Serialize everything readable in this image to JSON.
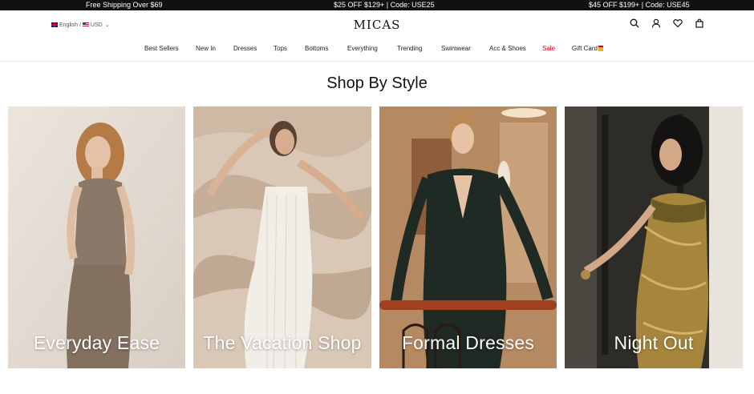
{
  "promo": {
    "left": "Free Shipping Over $69",
    "center": "$25 OFF $129+ | Code: USE25",
    "right": "$45 OFF $199+ | Code: USE45"
  },
  "header": {
    "language": "English",
    "separator": "/",
    "currency": "USD",
    "logo": "MICAS"
  },
  "nav": {
    "items": [
      "Best Sellers",
      "New In",
      "Dresses",
      "Tops",
      "Bottoms",
      "Everything",
      "Trending",
      "Swimwear",
      "Acc & Shoes",
      "Sale",
      "Gift Card"
    ]
  },
  "section": {
    "title": "Shop By Style"
  },
  "cards": [
    {
      "label": "Everyday Ease"
    },
    {
      "label": "The Vacation Shop"
    },
    {
      "label": "Formal Dresses"
    },
    {
      "label": "Night Out"
    }
  ],
  "colors": {
    "promo_bg": "#111111",
    "sale": "#d0021b",
    "text": "#111111"
  }
}
